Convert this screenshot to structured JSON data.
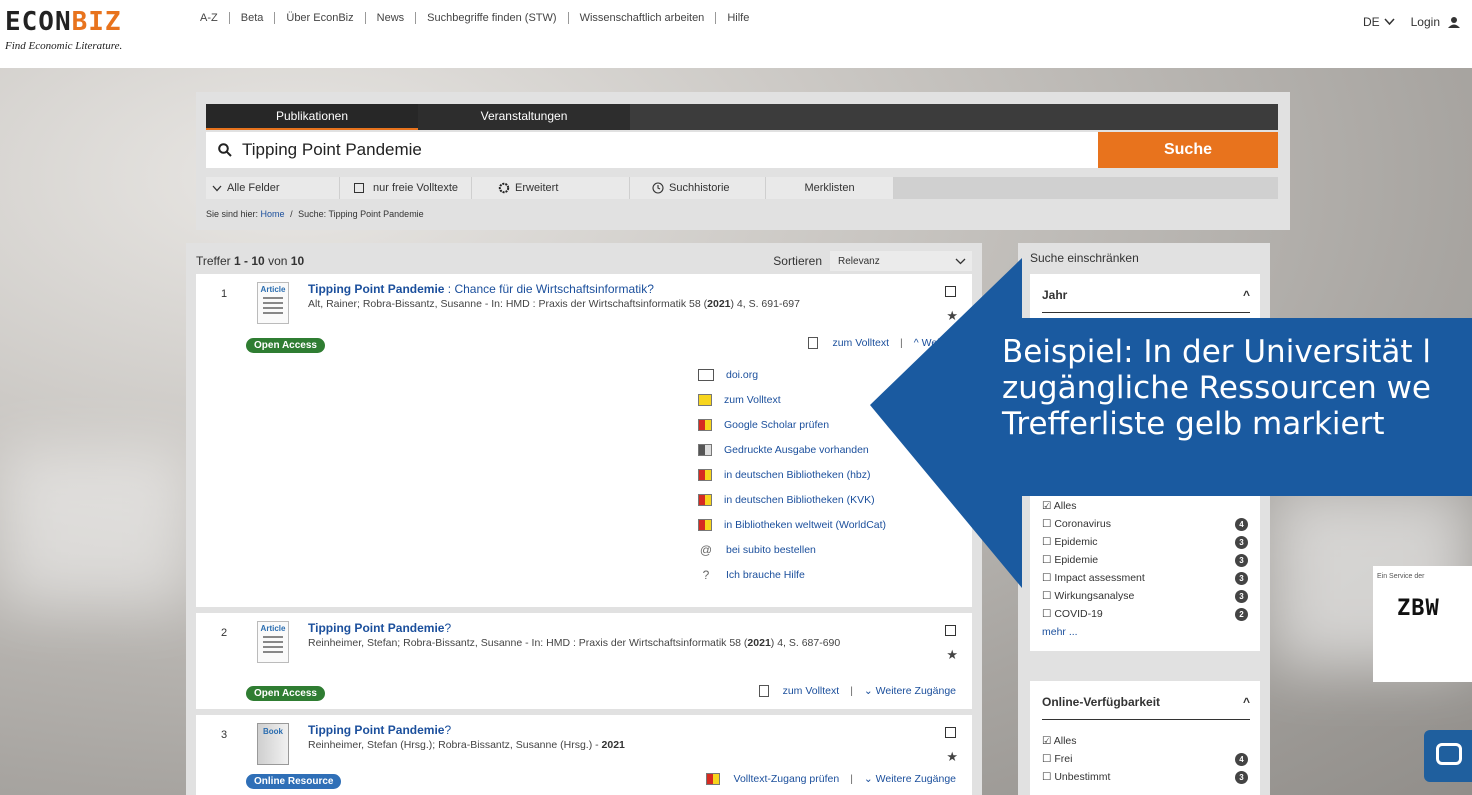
{
  "header": {
    "logo_main_a": "ECON",
    "logo_main_b": "BIZ",
    "logo_tagline": "Find Economic Literature.",
    "nav": [
      "A-Z",
      "Beta",
      "Über EconBiz",
      "News",
      "Suchbegriffe finden (STW)",
      "Wissenschaftlich arbeiten",
      "Hilfe"
    ],
    "language": "DE",
    "login": "Login"
  },
  "search": {
    "tabs": [
      "Publikationen",
      "Veranstaltungen"
    ],
    "query": "Tipping Point Pandemie",
    "button": "Suche",
    "options": {
      "fields": "Alle Felder",
      "free_fulltext": "nur freie Volltexte",
      "advanced": "Erweitert",
      "history": "Suchhistorie",
      "watchlists": "Merklisten"
    },
    "breadcrumb": {
      "prefix": "Sie sind hier:",
      "home": "Home",
      "separator": "/",
      "current": "Suche: Tipping Point Pandemie"
    }
  },
  "results": {
    "count_prefix": "Treffer",
    "range": "1 - 10",
    "count_of": "von",
    "total": "10",
    "sort_label": "Sortieren",
    "sort_value": "Relevanz",
    "items": [
      {
        "num": "1",
        "type": "Article",
        "title_main": "Tipping Point Pandemie",
        "title_rest": " : Chance für die Wirtschaftsinformatik?",
        "meta_pre": "Alt, Rainer; Robra-Bissantz, Susanne - In: HMD : Praxis der Wirtschaftsinformatik 58 (",
        "meta_year": "2021",
        "meta_post": ") 4, S. 691-697",
        "badge": "Open Access",
        "fulltext": "zum Volltext",
        "sep": "|",
        "more": "Weitere Zugänge"
      },
      {
        "num": "2",
        "type": "Article",
        "title_main": "Tipping Point Pandemie",
        "title_rest": "?",
        "meta_pre": "Reinheimer, Stefan; Robra-Bissantz, Susanne - In: HMD : Praxis der Wirtschaftsinformatik 58 (",
        "meta_year": "2021",
        "meta_post": ") 4, S. 687-690",
        "badge": "Open Access",
        "fulltext": "zum Volltext",
        "sep": "|",
        "more": "Weitere Zugänge"
      },
      {
        "num": "3",
        "type": "Book",
        "title_main": "Tipping Point Pandemie",
        "title_rest": "?",
        "meta_pre": "Reinheimer, Stefan (Hrsg.); Robra-Bissantz, Susanne (Hrsg.) - ",
        "meta_year": "2021",
        "meta_post": "",
        "badge": "Online Resource",
        "fulltext": "Volltext-Zugang prüfen",
        "sep": "|",
        "more": "Weitere Zugänge"
      }
    ],
    "access_links": [
      {
        "label": "doi.org",
        "icon": "document-icon"
      },
      {
        "label": "zum Volltext",
        "icon": "yellow-square-icon"
      },
      {
        "label": "Google Scholar prüfen",
        "icon": "red-yellow-square-icon"
      },
      {
        "label": "Gedruckte Ausgabe vorhanden",
        "icon": "grey-square-icon"
      },
      {
        "label": "in deutschen Bibliotheken (hbz)",
        "icon": "red-yellow-square-icon"
      },
      {
        "label": "in deutschen Bibliotheken (KVK)",
        "icon": "red-yellow-square-icon"
      },
      {
        "label": "in Bibliotheken weltweit (WorldCat)",
        "icon": "red-yellow-square-icon"
      },
      {
        "label": "bei subito bestellen",
        "icon": "at-icon"
      },
      {
        "label": "Ich brauche Hilfe",
        "icon": "question-icon"
      }
    ]
  },
  "facets": {
    "title": "Suche einschränken",
    "year": "Jahr",
    "subject_items": [
      {
        "label": "Alles",
        "count": ""
      },
      {
        "label": "Coronavirus",
        "count": "4"
      },
      {
        "label": "Epidemic",
        "count": "3"
      },
      {
        "label": "Epidemie",
        "count": "3"
      },
      {
        "label": "Impact assessment",
        "count": "3"
      },
      {
        "label": "Wirkungsanalyse",
        "count": "3"
      },
      {
        "label": "COVID-19",
        "count": "2"
      }
    ],
    "more": "mehr ...",
    "online": "Online-Verfügbarkeit",
    "online_items": [
      {
        "label": "Alles",
        "count": ""
      },
      {
        "label": "Frei",
        "count": "4"
      },
      {
        "label": "Unbestimmt",
        "count": "3"
      }
    ]
  },
  "zbw": {
    "service": "Ein Service der",
    "name": "ZBW"
  },
  "callout": {
    "line1": "Beispiel: In der Universität l",
    "line2": "zugängliche Ressourcen we",
    "line3": "Trefferliste gelb markiert",
    "color": "#1a5aa0"
  },
  "colors": {
    "accent": "#e8731d",
    "link": "#1b4f9c",
    "open_access": "#2f7d32",
    "online_resource": "#2f6fb7"
  }
}
